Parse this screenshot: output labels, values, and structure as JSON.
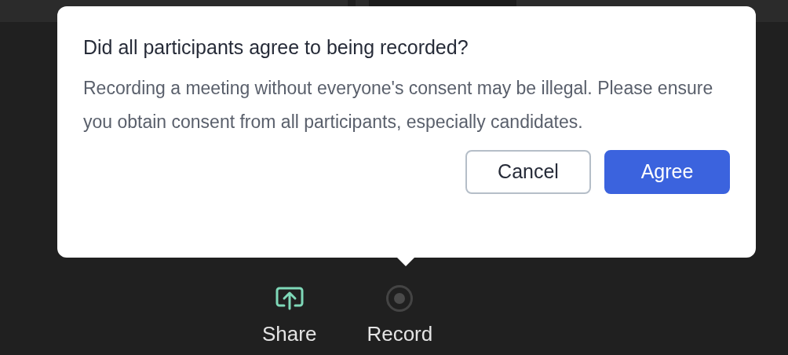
{
  "dialog": {
    "title": "Did all participants agree to being recorded?",
    "message": "Recording a meeting without everyone's consent may be illegal. Please ensure you obtain consent from all participants, especially candidates.",
    "buttons": [
      {
        "label": "Cancel",
        "kind": "secondary"
      },
      {
        "label": "Agree",
        "kind": "primary"
      }
    ]
  },
  "toolbar": [
    {
      "label": "Share",
      "kind": "share"
    },
    {
      "label": "Record",
      "kind": "record"
    }
  ]
}
